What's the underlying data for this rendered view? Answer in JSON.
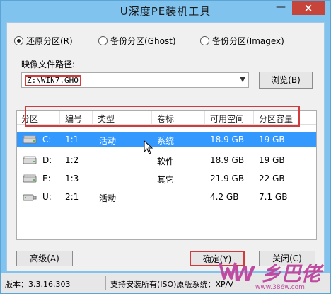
{
  "window": {
    "title": "U深度PE装机工具",
    "minimize_symbol": "—",
    "close_symbol": "×"
  },
  "modes": [
    {
      "label": "还原分区(R)",
      "checked": true
    },
    {
      "label": "备份分区(Ghost)",
      "checked": false
    },
    {
      "label": "备份分区(Imagex)",
      "checked": false
    }
  ],
  "image_path": {
    "label": "映像文件路径:",
    "value": "Z:\\WIN7.GHO",
    "browse_label": "浏览(B)"
  },
  "partition_table": {
    "columns": [
      "分区",
      "编号",
      "类型",
      "卷标",
      "可用空间",
      "分区容量"
    ],
    "rows": [
      {
        "drive": "C:",
        "number": "1:1",
        "type": "活动",
        "label": "系统",
        "free": "18.9 GB",
        "capacity": "19 GB",
        "selected": true,
        "icon": "hard-disk-icon"
      },
      {
        "drive": "D:",
        "number": "1:2",
        "type": "",
        "label": "软件",
        "free": "18.9 GB",
        "capacity": "19 GB",
        "selected": false,
        "icon": "hard-disk-icon"
      },
      {
        "drive": "E:",
        "number": "1:3",
        "type": "",
        "label": "其它",
        "free": "21.9 GB",
        "capacity": "22 GB",
        "selected": false,
        "icon": "hard-disk-icon"
      },
      {
        "drive": "U:",
        "number": "2:1",
        "type": "活动",
        "label": "",
        "free": "4.2 GB",
        "capacity": "7.1 GB",
        "selected": false,
        "icon": "usb-drive-icon"
      }
    ]
  },
  "buttons": {
    "advanced": "高级(A)",
    "confirm": "确定(Y)",
    "close": "关闭(C)"
  },
  "status": {
    "version": "版本：3.3.16.303",
    "support": "支持安装所有(ISO)原版系统：XP/V"
  },
  "watermark": {
    "text": "W 乡巴佬",
    "url": "www.386w.com"
  },
  "colors": {
    "titlebar": "#7fc3ee",
    "selection": "#3399ff",
    "highlight_box": "#d23b3b",
    "close_button": "#c7443a",
    "watermark": "#c04aa0"
  }
}
